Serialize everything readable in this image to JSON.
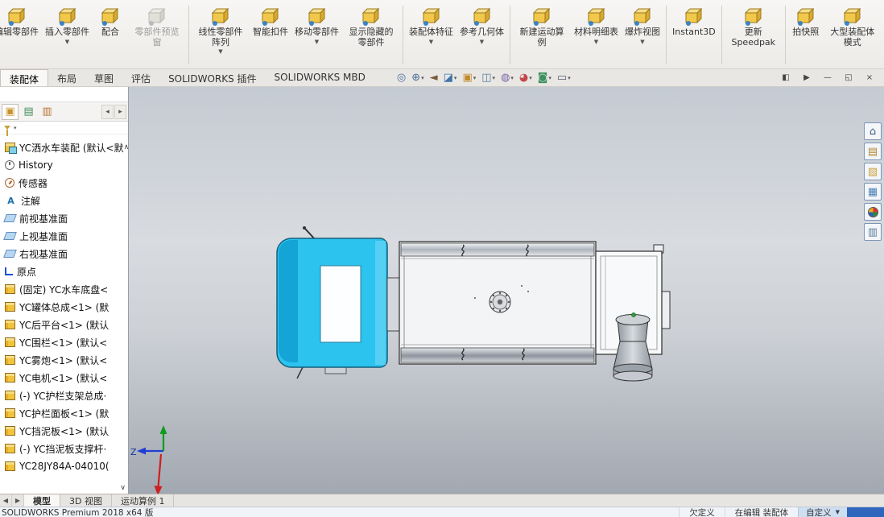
{
  "colors": {
    "cab_cyan": "#2cc3ee",
    "accent_blue": "#2f66bd",
    "part_icon_yellow": "#f2c33c",
    "viewport_gradient_top": "#c5cbd3",
    "viewport_gradient_bottom": "#a2a8b1"
  },
  "ribbon": {
    "items": [
      {
        "name": "edit-component",
        "label": "编辑零部件",
        "dropdown": false
      },
      {
        "name": "insert-components",
        "label": "插入零部件",
        "dropdown": true
      },
      {
        "name": "mate",
        "label": "配合",
        "dropdown": false
      },
      {
        "name": "component-preview-window",
        "label": "零部件预览窗",
        "dropdown": false,
        "disabled": true
      },
      {
        "type": "sep"
      },
      {
        "name": "linear-component-pattern",
        "label": "线性零部件阵列",
        "dropdown": true
      },
      {
        "name": "smart-fasteners",
        "label": "智能扣件",
        "dropdown": false
      },
      {
        "name": "move-component",
        "label": "移动零部件",
        "dropdown": true
      },
      {
        "name": "show-hidden-components",
        "label": "显示隐藏的零部件",
        "dropdown": false
      },
      {
        "type": "sep"
      },
      {
        "name": "assembly-features",
        "label": "装配体特征",
        "dropdown": true
      },
      {
        "name": "reference-geometry",
        "label": "参考几何体",
        "dropdown": true
      },
      {
        "type": "sep"
      },
      {
        "name": "new-motion-study",
        "label": "新建运动算例",
        "dropdown": false
      },
      {
        "name": "bill-of-materials",
        "label": "材料明细表",
        "dropdown": true
      },
      {
        "name": "exploded-view",
        "label": "爆炸视图",
        "dropdown": true
      },
      {
        "type": "sep"
      },
      {
        "name": "instant3d",
        "label": "Instant3D",
        "dropdown": false
      },
      {
        "type": "sep"
      },
      {
        "name": "update-speedpak",
        "label": "更新Speedpak",
        "dropdown": false
      },
      {
        "type": "sep"
      },
      {
        "name": "take-snapshot",
        "label": "拍快照",
        "dropdown": false
      },
      {
        "name": "large-assembly-mode",
        "label": "大型装配体模式",
        "dropdown": false
      }
    ],
    "dropdown_glyph": "▼"
  },
  "command_tabs": {
    "items": [
      {
        "label": "装配体",
        "active": true
      },
      {
        "label": "布局",
        "active": false
      },
      {
        "label": "草图",
        "active": false
      },
      {
        "label": "评估",
        "active": false
      },
      {
        "label": "SOLIDWORKS 插件",
        "active": false
      },
      {
        "label": "SOLIDWORKS MBD",
        "active": false
      }
    ]
  },
  "headsup": {
    "items": [
      {
        "name": "zoom-fit",
        "glyph": "◎",
        "color": "#4a6f9b",
        "dropdown": false
      },
      {
        "name": "zoom-area",
        "glyph": "⊕",
        "color": "#4a6f9b",
        "dropdown": true
      },
      {
        "name": "previous-view",
        "glyph": "◄",
        "color": "#7a5a3a",
        "dropdown": false
      },
      {
        "name": "section-view",
        "glyph": "◪",
        "color": "#3f74a8",
        "dropdown": true
      },
      {
        "name": "view-orientation",
        "glyph": "▣",
        "color": "#c28a2c",
        "dropdown": true
      },
      {
        "name": "display-style",
        "glyph": "◫",
        "color": "#5a7d9e",
        "dropdown": true
      },
      {
        "name": "hide-show-items",
        "glyph": "◍",
        "color": "#7a66a8",
        "dropdown": true
      },
      {
        "name": "edit-appearance",
        "glyph": "◕",
        "color": "#c2484a",
        "dropdown": true
      },
      {
        "name": "apply-scene",
        "glyph": "◙",
        "color": "#3f8f5f",
        "dropdown": true
      },
      {
        "name": "view-settings",
        "glyph": "▭",
        "color": "#555f6e",
        "dropdown": true
      }
    ],
    "dropdown_glyph": "▾"
  },
  "window_controls": {
    "items": [
      {
        "name": "previous-window",
        "glyph": "◧"
      },
      {
        "name": "next-window",
        "glyph": "▶"
      },
      {
        "name": "minimize-window",
        "glyph": "—"
      },
      {
        "name": "restore-window",
        "glyph": "◱"
      },
      {
        "name": "close-window",
        "glyph": "×"
      }
    ]
  },
  "panel": {
    "tabs": [
      {
        "name": "featuremanager",
        "glyph": "▣",
        "color": "#c7932a",
        "active": true
      },
      {
        "name": "propertymanager",
        "glyph": "▤",
        "color": "#3f8f5f",
        "active": false
      },
      {
        "name": "configurationmanager",
        "glyph": "▥",
        "color": "#b8743a",
        "active": false
      }
    ],
    "scroll_left_glyph": "◂",
    "scroll_right_glyph": "▸",
    "scroll_up_glyph": "∧",
    "scroll_down_glyph": "∨",
    "tree": {
      "root": {
        "label": "YC洒水车装配 (默认<默",
        "type": "assembly"
      },
      "items": [
        {
          "label": "History",
          "type": "history"
        },
        {
          "label": "传感器",
          "type": "sensor"
        },
        {
          "label": "注解",
          "type": "annotation"
        },
        {
          "label": "前视基准面",
          "type": "plane"
        },
        {
          "label": "上视基准面",
          "type": "plane"
        },
        {
          "label": "右视基准面",
          "type": "plane"
        },
        {
          "label": "原点",
          "type": "origin"
        },
        {
          "label": "(固定) YC水车底盘<",
          "type": "part"
        },
        {
          "label": "YC罐体总成<1> (默",
          "type": "part"
        },
        {
          "label": "YC后平台<1> (默认",
          "type": "part"
        },
        {
          "label": "YC围栏<1> (默认<",
          "type": "part"
        },
        {
          "label": "YC雾炮<1> (默认<",
          "type": "part"
        },
        {
          "label": "YC电机<1> (默认<",
          "type": "part"
        },
        {
          "label": "(-) YC护栏支架总成·",
          "type": "part"
        },
        {
          "label": "YC护栏面板<1> (默",
          "type": "part"
        },
        {
          "label": "YC挡泥板<1> (默认",
          "type": "part"
        },
        {
          "label": "(-) YC挡泥板支撑杆·",
          "type": "part"
        },
        {
          "label": "YC28JY84A-04010(",
          "type": "part"
        }
      ]
    }
  },
  "viewport": {
    "triad_z_label": "Z"
  },
  "task_pane": {
    "items": [
      {
        "name": "solidworks-resources",
        "glyph": "⌂",
        "color": "#3b5c84"
      },
      {
        "name": "design-library",
        "glyph": "▤",
        "color": "#b08830"
      },
      {
        "name": "file-explorer",
        "glyph": "▧",
        "color": "#c9a23a"
      },
      {
        "name": "view-palette",
        "glyph": "▦",
        "color": "#4a7fb5"
      },
      {
        "name": "appearances-scenes",
        "sphere": true
      },
      {
        "name": "custom-properties",
        "glyph": "▥",
        "color": "#5a7d9e"
      }
    ]
  },
  "doc_tabs": {
    "nav": [
      {
        "name": "tab-scroll-left",
        "glyph": "◀"
      },
      {
        "name": "tab-scroll-right",
        "glyph": "▶"
      }
    ],
    "items": [
      {
        "label": "模型",
        "active": true
      },
      {
        "label": "3D 视图",
        "active": false
      },
      {
        "label": "运动算例 1",
        "active": false
      }
    ]
  },
  "statusbar": {
    "left": "SOLIDWORKS Premium 2018 x64 版",
    "items": [
      "欠定义",
      "在编辑 装配体"
    ],
    "custom_label": "自定义",
    "custom_caret": "▼"
  }
}
